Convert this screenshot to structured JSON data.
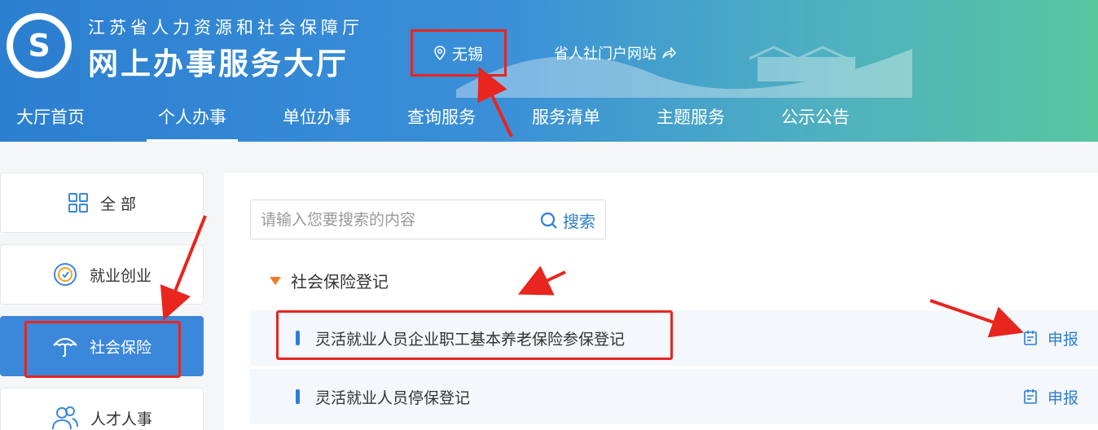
{
  "header": {
    "org_name": "江苏省人力资源和社会保障厅",
    "site_name": "网上办事服务大厅",
    "logo_glyph": "S",
    "location": "无锡",
    "portal_link": "省人社门户网站",
    "portal_icon": "share-icon",
    "location_icon": "map-pin-icon"
  },
  "nav": [
    {
      "label": "大厅首页"
    },
    {
      "label": "个人办事"
    },
    {
      "label": "单位办事"
    },
    {
      "label": "查询服务"
    },
    {
      "label": "服务清单"
    },
    {
      "label": "主题服务"
    },
    {
      "label": "公示公告"
    }
  ],
  "sidebar": [
    {
      "label": "全 部",
      "icon": "grid-icon"
    },
    {
      "label": "就业创业",
      "icon": "badge-icon"
    },
    {
      "label": "社会保险",
      "icon": "umbrella-icon"
    },
    {
      "label": "人才人事",
      "icon": "people-icon"
    }
  ],
  "search": {
    "placeholder": "请输入您要搜索的内容",
    "button_label": "搜索"
  },
  "section": {
    "title": "社会保险登记"
  },
  "items": [
    {
      "title": "灵活就业人员企业职工基本养老保险参保登记",
      "action": "申报"
    },
    {
      "title": "灵活就业人员停保登记",
      "action": "申报"
    }
  ],
  "colors": {
    "primary": "#2c7fd0",
    "annotation_red": "#e8251e",
    "section_marker": "#f07a2b"
  }
}
